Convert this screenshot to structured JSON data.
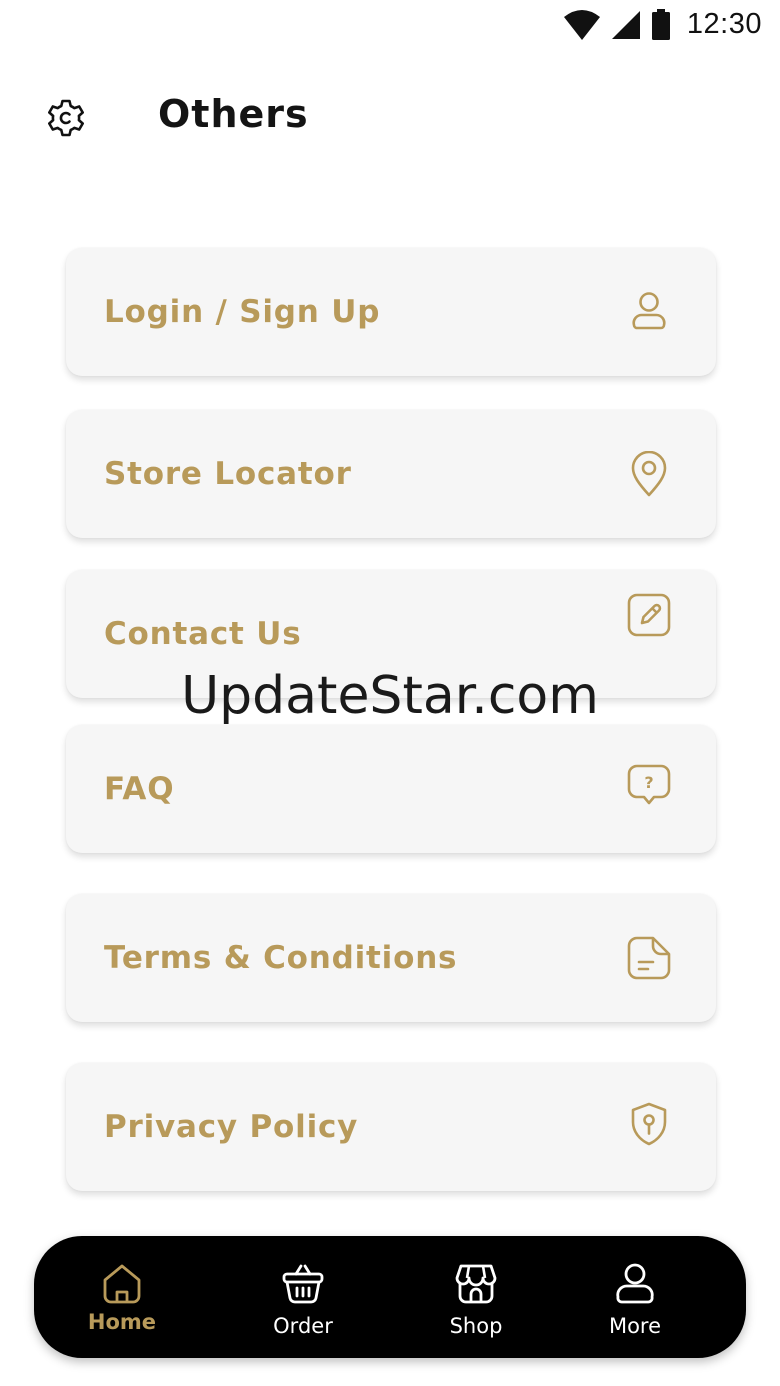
{
  "status_bar": {
    "time": "12:30",
    "icons": [
      "wifi-icon",
      "cellular-signal-icon",
      "battery-icon"
    ]
  },
  "header": {
    "title": "Others",
    "settings_icon": "gear-icon"
  },
  "menu": {
    "items": [
      {
        "label": "Login / Sign Up",
        "icon": "user-icon"
      },
      {
        "label": "Store Locator",
        "icon": "location-pin-icon"
      },
      {
        "label": "Contact Us",
        "icon": "edit-icon"
      },
      {
        "label": "FAQ",
        "icon": "question-chat-icon"
      },
      {
        "label": "Terms & Conditions",
        "icon": "document-icon"
      },
      {
        "label": "Privacy Policy",
        "icon": "shield-icon"
      }
    ]
  },
  "watermark": "UpdateStar.com",
  "bottom_nav": {
    "items": [
      {
        "label": "Home",
        "icon": "home-icon",
        "active": true
      },
      {
        "label": "Order",
        "icon": "basket-icon",
        "active": false
      },
      {
        "label": "Shop",
        "icon": "store-icon",
        "active": false
      },
      {
        "label": "More",
        "icon": "user-icon",
        "active": false
      }
    ]
  },
  "colors": {
    "accent": "#b89a5a",
    "card_background": "#f6f6f6",
    "nav_background": "#000000",
    "title": "#141414"
  }
}
